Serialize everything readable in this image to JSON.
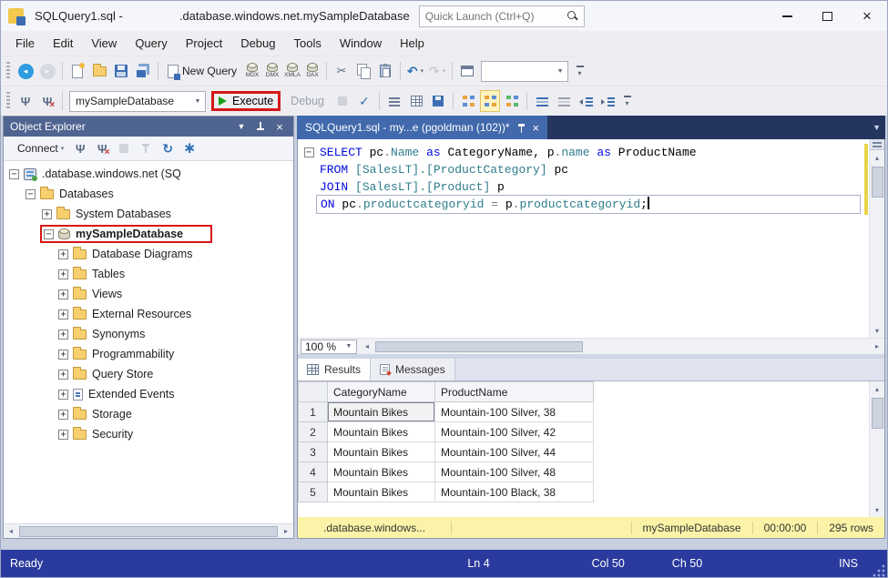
{
  "colors": {
    "annotation_red": "#d61717",
    "execute_green": "#18a018",
    "keyword_blue": "#0008dd",
    "qualifier_teal": "#2e7d8c",
    "status_bar_blue": "#2b3a9e",
    "results_status_yellow": "#fbf3a7",
    "panel_header_blue": "#4f6490",
    "active_tab_blue": "#4169ac"
  },
  "titlebar": {
    "title_left": "SQLQuery1.sql -",
    "title_right": ".database.windows.net.mySampleDatabase",
    "quick_launch": "Quick Launch (Ctrl+Q)"
  },
  "menubar": {
    "items": [
      "File",
      "Edit",
      "View",
      "Query",
      "Project",
      "Debug",
      "Tools",
      "Window",
      "Help"
    ]
  },
  "toolbar1": {
    "db_query_buttons": [
      "MDX",
      "DMX",
      "XMLA",
      "DAX"
    ],
    "items": [
      {
        "type": "grip"
      },
      {
        "type": "icon",
        "name": "nav-backward-button",
        "icon": "circle-back"
      },
      {
        "type": "icon",
        "name": "nav-forward-button",
        "icon": "circle-fwd",
        "disabled": true
      },
      {
        "type": "sep"
      },
      {
        "type": "icon",
        "name": "new-file-button",
        "icon": "doc-new"
      },
      {
        "type": "icon",
        "name": "open-file-button",
        "icon": "folder-open"
      },
      {
        "type": "icon",
        "name": "save-button",
        "icon": "floppy"
      },
      {
        "type": "icon",
        "name": "save-all-button",
        "icon": "floppy-all"
      },
      {
        "type": "sep"
      },
      {
        "type": "labelbtn",
        "name": "new-query-button",
        "icon": "doc-query",
        "label": "New Query"
      },
      {
        "type": "dbq"
      },
      {
        "type": "sep"
      },
      {
        "type": "icon",
        "name": "cut-button",
        "icon": "scissors"
      },
      {
        "type": "icon",
        "name": "copy-button",
        "icon": "copy"
      },
      {
        "type": "icon",
        "name": "paste-button",
        "icon": "clipboard"
      },
      {
        "type": "sep"
      },
      {
        "type": "icon-drop",
        "name": "undo-button",
        "icon": "undo"
      },
      {
        "type": "icon-drop",
        "name": "redo-button",
        "icon": "redo",
        "disabled": true
      },
      {
        "type": "sep"
      },
      {
        "type": "icon",
        "name": "activity-monitor-button",
        "icon": "win"
      },
      {
        "type": "combo",
        "name": "toolbar-combo",
        "value": "",
        "width": 96
      },
      {
        "type": "overflow",
        "name": "toolbar-options-button"
      }
    ]
  },
  "toolbar2": {
    "items": [
      {
        "type": "grip"
      },
      {
        "type": "icon",
        "name": "connect-button",
        "icon": "plug"
      },
      {
        "type": "icon",
        "name": "change-connection-button",
        "icon": "plug-x"
      },
      {
        "type": "sep"
      },
      {
        "type": "combo",
        "name": "available-databases-combo",
        "value": "mySampleDatabase",
        "width": 150
      },
      {
        "type": "exec",
        "name": "execute-button",
        "label": "Execute"
      },
      {
        "type": "label",
        "name": "debug-button",
        "label": "Debug",
        "disabled": true
      },
      {
        "type": "icon",
        "name": "stop-button",
        "icon": "stop",
        "disabled": true
      },
      {
        "type": "icon",
        "name": "parse-button",
        "icon": "check"
      },
      {
        "type": "sep"
      },
      {
        "type": "icon",
        "name": "results-to-text-button",
        "icon": "text-lines"
      },
      {
        "type": "icon",
        "name": "results-to-grid-button",
        "icon": "grid"
      },
      {
        "type": "icon",
        "name": "results-to-file-button",
        "icon": "floppy-small"
      },
      {
        "type": "sep"
      },
      {
        "type": "icon",
        "name": "show-estimated-plan-button",
        "icon": "plan"
      },
      {
        "type": "icon",
        "name": "include-actual-plan-button",
        "icon": "plan",
        "highlighted": true
      },
      {
        "type": "icon",
        "name": "include-live-stats-button",
        "icon": "plan2"
      },
      {
        "type": "sep"
      },
      {
        "type": "icon",
        "name": "comment-button",
        "icon": "comment"
      },
      {
        "type": "icon",
        "name": "uncomment-button",
        "icon": "uncomment"
      },
      {
        "type": "icon",
        "name": "decrease-indent-button",
        "icon": "outdent"
      },
      {
        "type": "icon",
        "name": "increase-indent-button",
        "icon": "indent"
      },
      {
        "type": "overflow",
        "name": "toolbar2-options-button"
      }
    ]
  },
  "object_explorer": {
    "title": "Object Explorer",
    "toolbar": [
      {
        "type": "labeldrop",
        "name": "connect-menu",
        "label": "Connect"
      },
      {
        "type": "icon",
        "name": "connect-object-button",
        "icon": "plug"
      },
      {
        "type": "icon",
        "name": "disconnect-button",
        "icon": "plug-x"
      },
      {
        "type": "icon",
        "name": "stop-oe-button",
        "icon": "stop",
        "disabled": true
      },
      {
        "type": "icon",
        "name": "filter-button",
        "icon": "funnel",
        "disabled": true
      },
      {
        "type": "icon",
        "name": "refresh-button",
        "icon": "refresh"
      },
      {
        "type": "icon",
        "name": "options-button",
        "icon": "spark"
      }
    ],
    "tree": [
      {
        "label": ".database.windows.net (SQ",
        "level": 0,
        "toggle": "minus",
        "icon": "server"
      },
      {
        "label": "Databases",
        "level": 1,
        "toggle": "minus",
        "icon": "folder"
      },
      {
        "label": "System Databases",
        "level": 2,
        "toggle": "plus",
        "icon": "folder"
      },
      {
        "label": "mySampleDatabase",
        "level": 2,
        "toggle": "minus",
        "icon": "database",
        "highlighted": true
      },
      {
        "label": "Database Diagrams",
        "level": 3,
        "toggle": "plus",
        "icon": "folder"
      },
      {
        "label": "Tables",
        "level": 3,
        "toggle": "plus",
        "icon": "folder"
      },
      {
        "label": "Views",
        "level": 3,
        "toggle": "plus",
        "icon": "folder"
      },
      {
        "label": "External Resources",
        "level": 3,
        "toggle": "plus",
        "icon": "folder"
      },
      {
        "label": "Synonyms",
        "level": 3,
        "toggle": "plus",
        "icon": "folder"
      },
      {
        "label": "Programmability",
        "level": 3,
        "toggle": "plus",
        "icon": "folder"
      },
      {
        "label": "Query Store",
        "level": 3,
        "toggle": "plus",
        "icon": "folder"
      },
      {
        "label": "Extended Events",
        "level": 3,
        "toggle": "plus",
        "icon": "events"
      },
      {
        "label": "Storage",
        "level": 3,
        "toggle": "plus",
        "icon": "folder"
      },
      {
        "label": "Security",
        "level": 3,
        "toggle": "plus",
        "icon": "folder"
      }
    ]
  },
  "document": {
    "tab_title": "SQLQuery1.sql - my...e (pgoldman (102))*",
    "zoom": "100 %",
    "code_lines": [
      {
        "fold": "minus",
        "tokens": [
          [
            "kw",
            "SELECT "
          ],
          [
            "id",
            "pc"
          ],
          [
            "op",
            "."
          ],
          [
            "qual",
            "Name"
          ],
          [
            "id",
            " "
          ],
          [
            "kw",
            "as"
          ],
          [
            "id",
            " CategoryName, "
          ],
          [
            "id",
            "p"
          ],
          [
            "op",
            "."
          ],
          [
            "qual",
            "name"
          ],
          [
            "id",
            " "
          ],
          [
            "kw",
            "as"
          ],
          [
            "id",
            " ProductName"
          ]
        ]
      },
      {
        "tokens": [
          [
            "kw",
            "FROM "
          ],
          [
            "qual",
            "[SalesLT].[ProductCategory]"
          ],
          [
            "id",
            " pc"
          ]
        ]
      },
      {
        "tokens": [
          [
            "kw",
            "JOIN "
          ],
          [
            "qual",
            "[SalesLT].[Product]"
          ],
          [
            "id",
            " p"
          ]
        ]
      },
      {
        "current": true,
        "caret": true,
        "tokens": [
          [
            "kw",
            "ON "
          ],
          [
            "id",
            "pc"
          ],
          [
            "op",
            "."
          ],
          [
            "qual",
            "productcategoryid"
          ],
          [
            "id",
            " "
          ],
          [
            "op",
            "="
          ],
          [
            "id",
            " "
          ],
          [
            "id",
            "p"
          ],
          [
            "op",
            "."
          ],
          [
            "qual",
            "productcategoryid"
          ],
          [
            "id",
            ";"
          ]
        ]
      }
    ]
  },
  "results": {
    "tabs": [
      {
        "label": "Results",
        "active": true
      },
      {
        "label": "Messages",
        "active": false
      }
    ],
    "grid": {
      "columns": [
        "CategoryName",
        "ProductName"
      ],
      "rows": [
        {
          "num": "1",
          "cells": [
            "Mountain Bikes",
            "Mountain-100 Silver, 38"
          ]
        },
        {
          "num": "2",
          "cells": [
            "Mountain Bikes",
            "Mountain-100 Silver, 42"
          ]
        },
        {
          "num": "3",
          "cells": [
            "Mountain Bikes",
            "Mountain-100 Silver, 44"
          ]
        },
        {
          "num": "4",
          "cells": [
            "Mountain Bikes",
            "Mountain-100 Silver, 48"
          ]
        },
        {
          "num": "5",
          "cells": [
            "Mountain Bikes",
            "Mountain-100 Black, 38"
          ]
        }
      ]
    },
    "status": {
      "server": ".database.windows...",
      "database": "mySampleDatabase",
      "elapsed": "00:00:00",
      "rowcount": "295 rows"
    }
  },
  "statusbar": {
    "state": "Ready",
    "line": "Ln 4",
    "column": "Col 50",
    "char": "Ch 50",
    "mode": "INS"
  }
}
